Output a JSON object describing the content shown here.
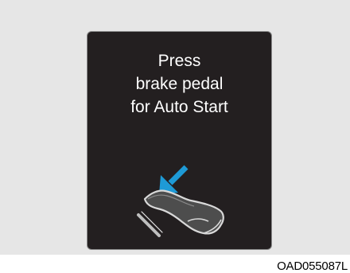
{
  "display": {
    "line1": "Press",
    "line2": "brake pedal",
    "line3": "for Auto Start"
  },
  "figure": {
    "code": "OAD055087L"
  },
  "icons": {
    "arrow": "down-left-arrow-icon",
    "pedal": "foot-on-brake-pedal-icon"
  },
  "colors": {
    "display_background": "#231f20",
    "arrow": "#1e9ad6",
    "text": "#ffffff"
  }
}
